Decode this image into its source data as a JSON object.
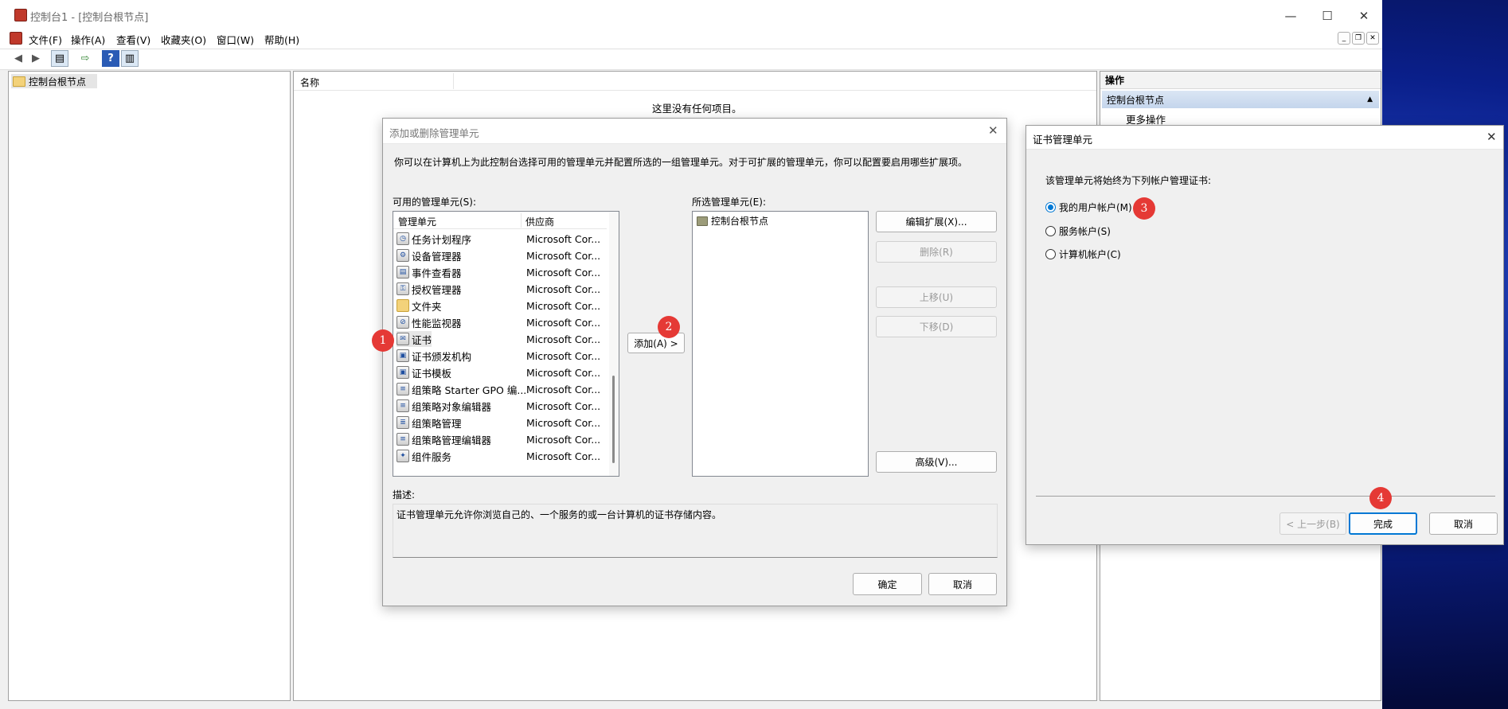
{
  "window": {
    "title": "控制台1 - [控制台根节点]",
    "minimize": "—",
    "maximize": "☐",
    "close": "✕"
  },
  "menu": [
    "文件(F)",
    "操作(A)",
    "查看(V)",
    "收藏夹(O)",
    "窗口(W)",
    "帮助(H)"
  ],
  "tree": {
    "root": "控制台根节点"
  },
  "center": {
    "column_name": "名称",
    "empty_message": "这里没有任何项目。"
  },
  "actions": {
    "header": "操作",
    "section": "控制台根节点",
    "more": "更多操作"
  },
  "snapin_dialog": {
    "title": "添加或删除管理单元",
    "intro": "你可以在计算机上为此控制台选择可用的管理单元并配置所选的一组管理单元。对于可扩展的管理单元，你可以配置要启用哪些扩展项。",
    "available_label": "可用的管理单元(S):",
    "col_snapin": "管理单元",
    "col_vendor": "供应商",
    "available": [
      {
        "name": "任务计划程序",
        "vendor": "Microsoft Cor...",
        "icon": "clock-icon"
      },
      {
        "name": "设备管理器",
        "vendor": "Microsoft Cor...",
        "icon": "device-manager-icon"
      },
      {
        "name": "事件查看器",
        "vendor": "Microsoft Cor...",
        "icon": "event-viewer-icon"
      },
      {
        "name": "授权管理器",
        "vendor": "Microsoft Cor...",
        "icon": "authorization-icon"
      },
      {
        "name": "文件夹",
        "vendor": "Microsoft Cor...",
        "icon": "folder-icon"
      },
      {
        "name": "性能监视器",
        "vendor": "Microsoft Cor...",
        "icon": "performance-icon"
      },
      {
        "name": "证书",
        "vendor": "Microsoft Cor...",
        "icon": "certificate-icon"
      },
      {
        "name": "证书颁发机构",
        "vendor": "Microsoft Cor...",
        "icon": "cert-authority-icon"
      },
      {
        "name": "证书模板",
        "vendor": "Microsoft Cor...",
        "icon": "cert-template-icon"
      },
      {
        "name": "组策略 Starter GPO 编...",
        "vendor": "Microsoft Cor...",
        "icon": "policy-icon"
      },
      {
        "name": "组策略对象编辑器",
        "vendor": "Microsoft Cor...",
        "icon": "policy-icon"
      },
      {
        "name": "组策略管理",
        "vendor": "Microsoft Cor...",
        "icon": "policy-mgmt-icon"
      },
      {
        "name": "组策略管理编辑器",
        "vendor": "Microsoft Cor...",
        "icon": "policy-icon"
      },
      {
        "name": "组件服务",
        "vendor": "Microsoft Cor...",
        "icon": "component-services-icon"
      }
    ],
    "add_button": "添加(A) >",
    "selected_label": "所选管理单元(E):",
    "selected": [
      "控制台根节点"
    ],
    "edit_ext": "编辑扩展(X)...",
    "remove": "删除(R)",
    "move_up": "上移(U)",
    "move_down": "下移(D)",
    "advanced": "高级(V)...",
    "desc_label": "描述:",
    "description": "证书管理单元允许你浏览自己的、一个服务的或一台计算机的证书存储内容。",
    "ok": "确定",
    "cancel": "取消"
  },
  "cert_dialog": {
    "title": "证书管理单元",
    "prompt": "该管理单元将始终为下列帐户管理证书:",
    "options": [
      "我的用户帐户(M)",
      "服务帐户(S)",
      "计算机帐户(C)"
    ],
    "selected_index": 0,
    "back": "< 上一步(B)",
    "finish": "完成",
    "cancel": "取消"
  },
  "badges": [
    "1",
    "2",
    "3",
    "4"
  ],
  "colors": {
    "accent": "#0078d4",
    "badge": "#e53935"
  }
}
